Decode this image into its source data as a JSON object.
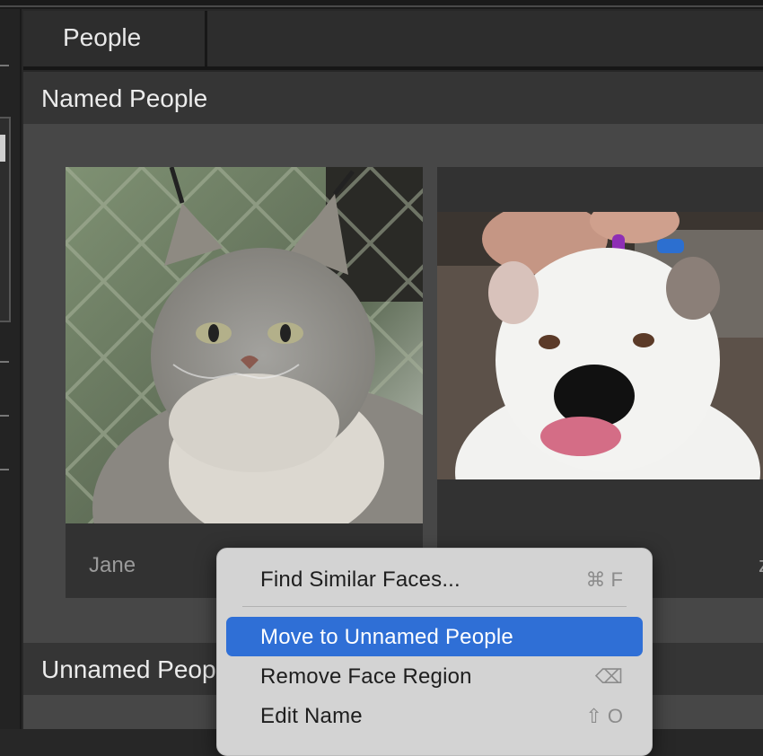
{
  "tabs": {
    "active_label": "People"
  },
  "named_section": {
    "title": "Named People",
    "cards": [
      {
        "name": "Jane"
      },
      {
        "name": "z"
      }
    ]
  },
  "unnamed_section": {
    "title": "Unnamed People"
  },
  "context_menu": {
    "items": [
      {
        "label": "Find Similar Faces...",
        "shortcut": "⌘ F"
      },
      {
        "label": "Move to Unnamed People",
        "shortcut": ""
      },
      {
        "label": "Remove Face Region",
        "shortcut": "⌫"
      },
      {
        "label": "Edit Name",
        "shortcut": "⇧ O"
      }
    ],
    "highlighted_index": 1
  },
  "colors": {
    "highlight": "#2f6fd6",
    "background": "#272727",
    "menu_bg": "#d3d3d3"
  }
}
